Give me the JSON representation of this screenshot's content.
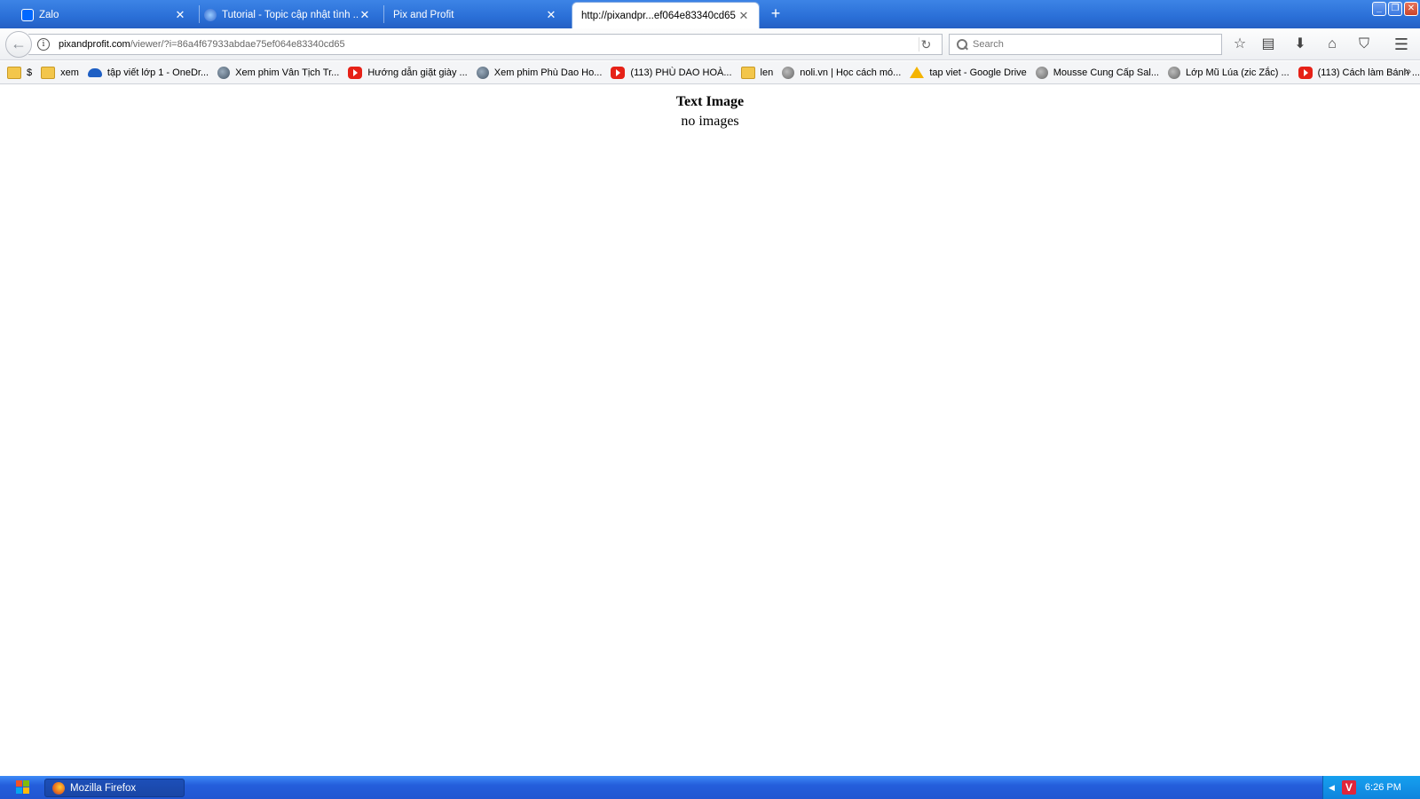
{
  "window": {
    "app_title": "Mozilla Firefox"
  },
  "tabs": [
    {
      "label": "Zalo",
      "icon": "zalo-icon",
      "active": false
    },
    {
      "label": "Tutorial - Topic cập nhật tình ...",
      "icon": "globe-icon",
      "active": false
    },
    {
      "label": "Pix and Profit",
      "icon": "",
      "active": false
    },
    {
      "label": "http://pixandpr...ef064e83340cd65",
      "icon": "",
      "active": true
    }
  ],
  "urlbar": {
    "host": "pixandprofit.com",
    "path": "/viewer/?i=86a4f67933abdae75ef064e83340cd65"
  },
  "search": {
    "placeholder": "Search"
  },
  "bookmarks": [
    {
      "label": "$",
      "icon": "folder"
    },
    {
      "label": "xem",
      "icon": "folder"
    },
    {
      "label": "tập viết lớp 1 - OneDr...",
      "icon": "cloud"
    },
    {
      "label": "Xem phim Vân Tịch Tr...",
      "icon": "film"
    },
    {
      "label": "Hướng dẫn giặt giày ...",
      "icon": "youtube"
    },
    {
      "label": "Xem phim Phù Dao Ho...",
      "icon": "film"
    },
    {
      "label": "(113) PHÙ DAO HOÀ...",
      "icon": "youtube"
    },
    {
      "label": "len",
      "icon": "folder"
    },
    {
      "label": "noli.vn | Học cách mó...",
      "icon": "globe"
    },
    {
      "label": "tap viet - Google Drive",
      "icon": "drive"
    },
    {
      "label": "Mousse Cung Cấp Sal...",
      "icon": "globe"
    },
    {
      "label": "Lớp Mũ Lúa (zic Zắc) ...",
      "icon": "globe"
    },
    {
      "label": "(113) Cách làm Bánh ...",
      "icon": "youtube"
    }
  ],
  "page": {
    "title": "Text Image",
    "subtitle": "no images"
  },
  "taskbar": {
    "task_label": "Mozilla Firefox",
    "tray_v": "V",
    "time": "6:26 PM"
  },
  "colors": {
    "tab_strip": "#2a6fd7",
    "taskbar": "#245edb",
    "tray": "#0f84dd"
  }
}
